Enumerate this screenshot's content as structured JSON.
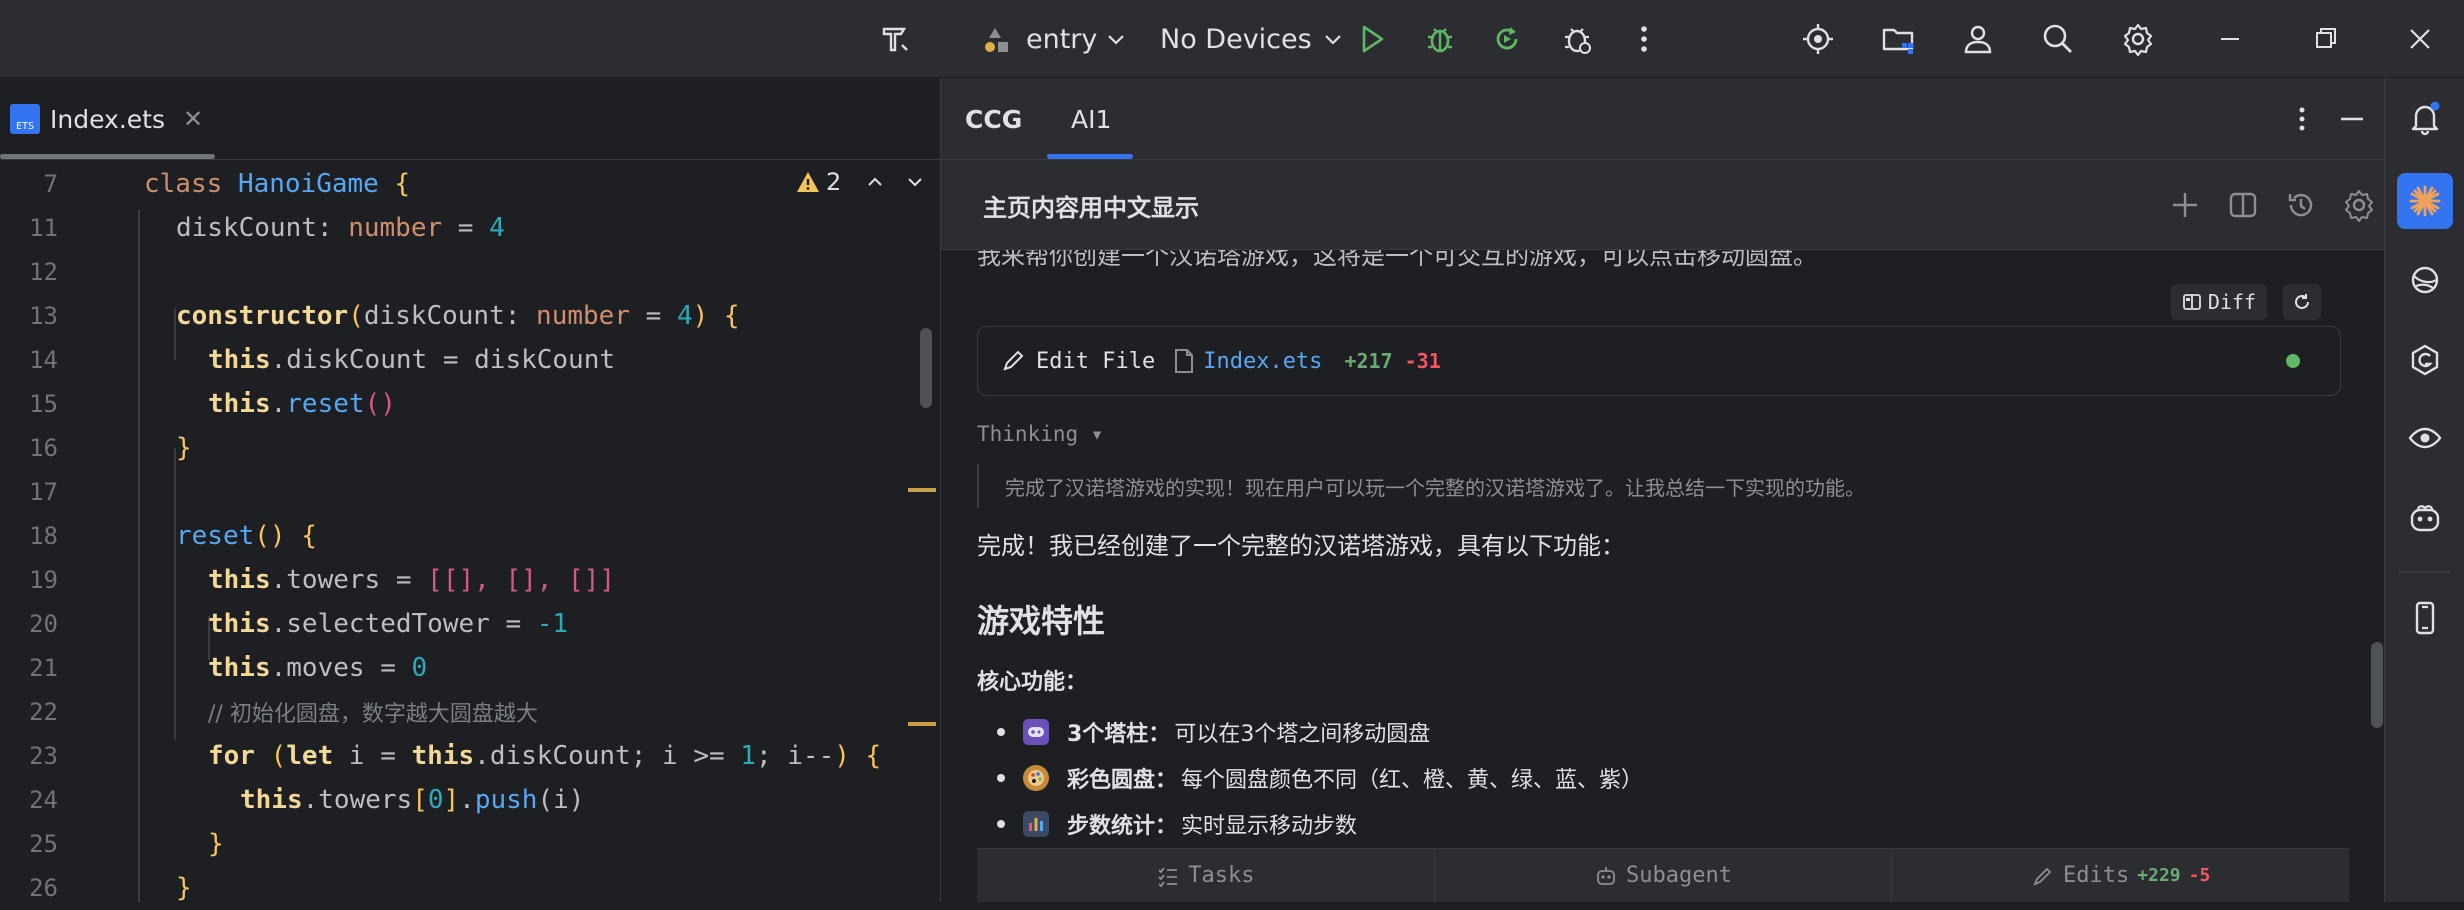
{
  "titlebar": {
    "run_config": "entry",
    "devices": "No Devices",
    "icons": [
      "hammer-icon",
      "module-icon",
      "chevron-down-icon",
      "run-icon",
      "debug-icon",
      "rerun-icon",
      "profile-icon",
      "more-vert-icon",
      "target-icon",
      "folder-icon",
      "account-icon",
      "search-icon",
      "gear-icon",
      "minimize-icon",
      "restore-icon",
      "close-icon"
    ]
  },
  "editor": {
    "tab_name": "Index.ets",
    "tab_close": "✕",
    "file_badge": "ETS",
    "warning_count": "2",
    "lines": [
      {
        "n": "7"
      },
      {
        "n": "11"
      },
      {
        "n": "12"
      },
      {
        "n": "13"
      },
      {
        "n": "14"
      },
      {
        "n": "15"
      },
      {
        "n": "16"
      },
      {
        "n": "17"
      },
      {
        "n": "18"
      },
      {
        "n": "19"
      },
      {
        "n": "20"
      },
      {
        "n": "21"
      },
      {
        "n": "22"
      },
      {
        "n": "23"
      },
      {
        "n": "24"
      },
      {
        "n": "25"
      },
      {
        "n": "26"
      }
    ],
    "tok": {
      "class_kw": "class",
      "class_name": "HanoiGame",
      "brace_open": "{",
      "brace_close": "}",
      "diskCount": "diskCount",
      "colon": ":",
      "number": "number",
      "eq": "=",
      "four": "4",
      "constructor": "constructor",
      "paren_open": "(",
      "paren_close": ")",
      "this": "this",
      "dot": ".",
      "reset": "reset",
      "empty_parens": "()",
      "towers": "towers",
      "arr_open": "[",
      "arr_close": "]",
      "arrs": "[], [], []",
      "selectedTower": "selectedTower",
      "minus_one": "-1",
      "moves": "moves",
      "zero": "0",
      "comment": "// 初始化圆盘，数字越大圆盘越大",
      "for": "for",
      "let": "let",
      "i": "i",
      "gte": ">=",
      "one": "1",
      "semi": ";",
      "idec": "i--",
      "push": "push"
    }
  },
  "ai": {
    "tabs": [
      {
        "label": "CCG"
      },
      {
        "label": "AI1"
      }
    ],
    "header_title": "主页内容用中文显示",
    "cut_text": "我来帮你创建一个汉诺塔游戏，这将是一个可交互的游戏，可以点击移动圆盘。",
    "diff_label": "Diff",
    "edit_card": {
      "label": "Edit File",
      "file": "Index.ets",
      "added": "+217",
      "removed": "-31"
    },
    "thinking_label": "Thinking ▾",
    "thinking_text": "完成了汉诺塔游戏的实现！现在用户可以玩一个完整的汉诺塔游戏了。让我总结一下实现的功能。",
    "done_text": "完成！我已经创建了一个完整的汉诺塔游戏，具有以下功能：",
    "section_title": "游戏特性",
    "core_label": "核心功能：",
    "bullets": [
      {
        "bold": "3个塔柱：",
        "text": "可以在3个塔之间移动圆盘",
        "icon": "gamepad-icon",
        "color": "#6b4fbb"
      },
      {
        "bold": "彩色圆盘：",
        "text": "每个圆盘颜色不同（红、橙、黄、绿、蓝、紫）",
        "icon": "palette-icon",
        "color": "#c98a3a"
      },
      {
        "bold": "步数统计：",
        "text": "实时显示移动步数",
        "icon": "bar-chart-icon",
        "color": "#3574f0"
      }
    ],
    "footer": {
      "tasks": "Tasks",
      "subagent": "Subagent",
      "edits": "Edits",
      "edits_added": "+229",
      "edits_removed": "-5"
    }
  },
  "colors": {
    "accent": "#3574f0",
    "added": "#6aab73",
    "removed": "#f75464",
    "run": "#5fb865",
    "status_dot": "#5fb865"
  }
}
